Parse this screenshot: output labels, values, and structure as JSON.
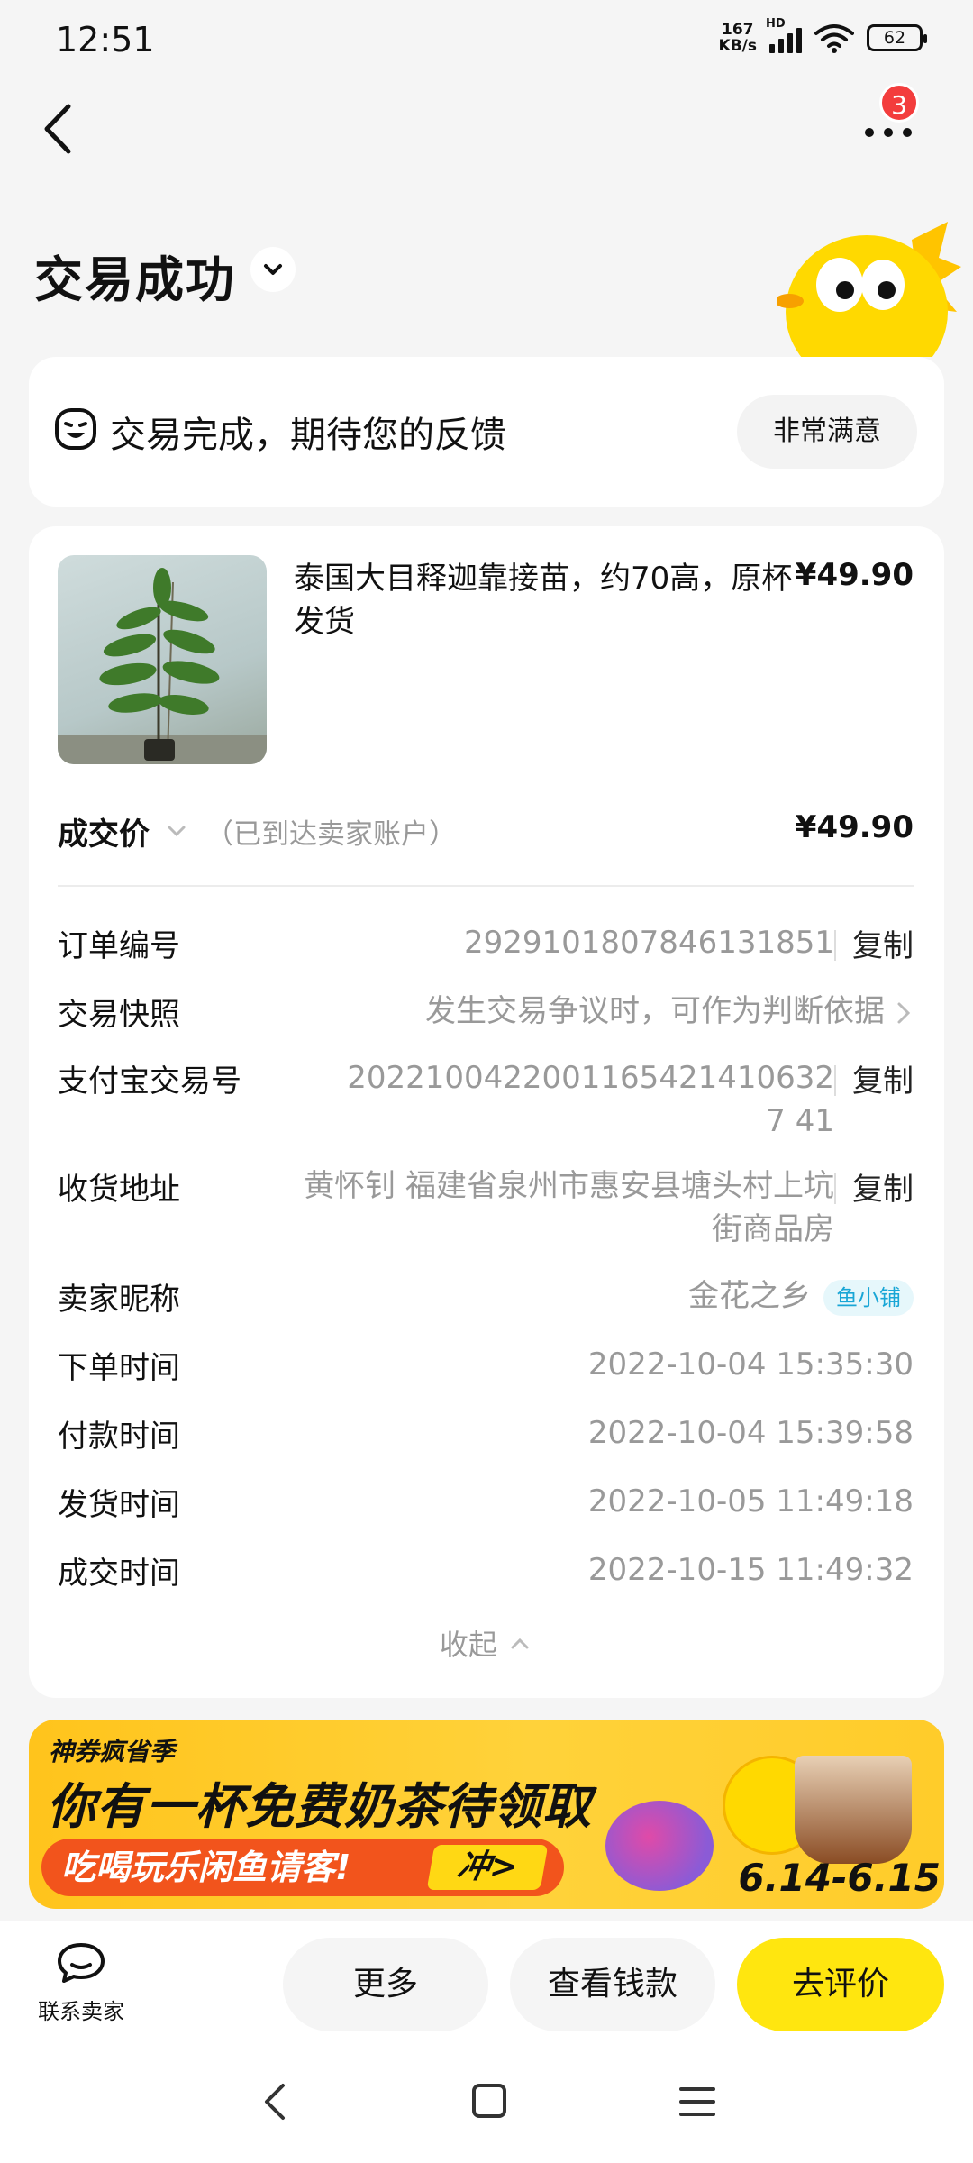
{
  "status_bar": {
    "time": "12:51",
    "net_speed_value": "167",
    "net_speed_unit": "KB/s",
    "net_type": "HD",
    "battery": "62"
  },
  "header": {
    "notification_count": "3",
    "title": "交易成功"
  },
  "feedback": {
    "text": "交易完成，期待您的反馈",
    "button": "非常满意"
  },
  "product": {
    "title": "泰国大目释迦靠接苗，约70高，原杯发货",
    "price": "¥49.90"
  },
  "deal": {
    "label": "成交价",
    "note": "（已到达卖家账户）",
    "price": "¥49.90"
  },
  "details": {
    "order_no_label": "订单编号",
    "order_no": "2929101807846131851",
    "snapshot_label": "交易快照",
    "snapshot_value": "发生交易争议时，可作为判断依据",
    "alipay_label": "支付宝交易号",
    "alipay_no": "20221004220011654214106327 41",
    "address_label": "收货地址",
    "address": "黄怀钊 福建省泉州市惠安县塘头村上坑街商品房",
    "seller_label": "卖家昵称",
    "seller": "金花之乡",
    "seller_tag": "鱼小铺",
    "order_time_label": "下单时间",
    "order_time": "2022-10-04 15:35:30",
    "pay_time_label": "付款时间",
    "pay_time": "2022-10-04 15:39:58",
    "ship_time_label": "发货时间",
    "ship_time": "2022-10-05 11:49:18",
    "deal_time_label": "成交时间",
    "deal_time": "2022-10-15 11:49:32",
    "copy": "复制",
    "collapse": "收起"
  },
  "banner": {
    "tag": "神券疯省季",
    "headline": "你有一杯免费奶茶待领取",
    "sub": "吃喝玩乐闲鱼请客!",
    "go": "冲>",
    "dates": "6.14-6.15"
  },
  "bottom_bar": {
    "contact": "联系卖家",
    "more": "更多",
    "view_money": "查看钱款",
    "review": "去评价"
  },
  "colors": {
    "accent_yellow": "#ffe60f",
    "badge_red": "#f33d3d",
    "banner_orange": "#f2541c"
  }
}
